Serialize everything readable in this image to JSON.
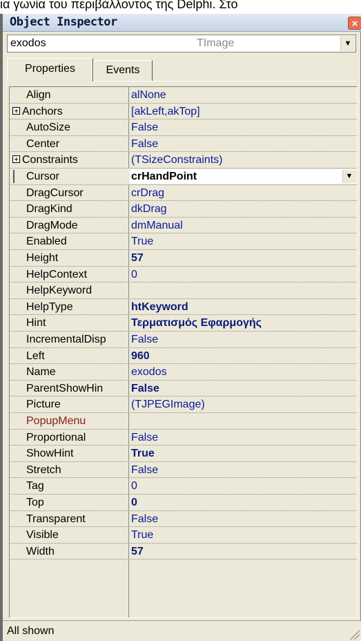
{
  "document_text": "ια γωνία του περιβάλλοντός της Delphi. Στο",
  "window": {
    "title": "Object Inspector",
    "close_glyph": "×"
  },
  "selector": {
    "object_name": "exodos",
    "class_name": "TImage",
    "arrow": "▼"
  },
  "tabs": [
    {
      "label": "Properties",
      "active": true
    },
    {
      "label": "Events",
      "active": false
    }
  ],
  "properties": [
    {
      "name": "Align",
      "value": "alNone",
      "bold": false,
      "expander": false
    },
    {
      "name": "Anchors",
      "value": "[akLeft,akTop]",
      "bold": false,
      "expander": true
    },
    {
      "name": "AutoSize",
      "value": "False",
      "bold": false,
      "expander": false
    },
    {
      "name": "Center",
      "value": "False",
      "bold": false,
      "expander": false
    },
    {
      "name": "Constraints",
      "value": "(TSizeConstraints)",
      "bold": false,
      "expander": true
    },
    {
      "name": "Cursor",
      "value": "crHandPoint",
      "bold": true,
      "expander": false,
      "selected": true
    },
    {
      "name": "DragCursor",
      "value": "crDrag",
      "bold": false,
      "expander": false
    },
    {
      "name": "DragKind",
      "value": "dkDrag",
      "bold": false,
      "expander": false
    },
    {
      "name": "DragMode",
      "value": "dmManual",
      "bold": false,
      "expander": false
    },
    {
      "name": "Enabled",
      "value": "True",
      "bold": false,
      "expander": false
    },
    {
      "name": "Height",
      "value": "57",
      "bold": true,
      "expander": false
    },
    {
      "name": "HelpContext",
      "value": "0",
      "bold": false,
      "expander": false
    },
    {
      "name": "HelpKeyword",
      "value": "",
      "bold": false,
      "expander": false
    },
    {
      "name": "HelpType",
      "value": "htKeyword",
      "bold": true,
      "expander": false
    },
    {
      "name": "Hint",
      "value": "Τερματισμός Εφαρμογής",
      "bold": true,
      "expander": false
    },
    {
      "name": "IncrementalDisp",
      "value": "False",
      "bold": false,
      "expander": false
    },
    {
      "name": "Left",
      "value": "960",
      "bold": true,
      "expander": false
    },
    {
      "name": "Name",
      "value": "exodos",
      "bold": false,
      "expander": false
    },
    {
      "name": "ParentShowHin",
      "value": "False",
      "bold": true,
      "expander": false
    },
    {
      "name": "Picture",
      "value": "(TJPEGImage)",
      "bold": false,
      "expander": false
    },
    {
      "name": "PopupMenu",
      "value": "",
      "bold": false,
      "expander": false,
      "name_color": "#8b1a1a"
    },
    {
      "name": "Proportional",
      "value": "False",
      "bold": false,
      "expander": false
    },
    {
      "name": "ShowHint",
      "value": "True",
      "bold": true,
      "expander": false
    },
    {
      "name": "Stretch",
      "value": "False",
      "bold": false,
      "expander": false
    },
    {
      "name": "Tag",
      "value": "0",
      "bold": false,
      "expander": false
    },
    {
      "name": "Top",
      "value": "0",
      "bold": true,
      "expander": false
    },
    {
      "name": "Transparent",
      "value": "False",
      "bold": false,
      "expander": false
    },
    {
      "name": "Visible",
      "value": "True",
      "bold": false,
      "expander": false
    },
    {
      "name": "Width",
      "value": "57",
      "bold": true,
      "expander": false
    }
  ],
  "expander_glyph": "+",
  "status": {
    "text": "All shown"
  }
}
